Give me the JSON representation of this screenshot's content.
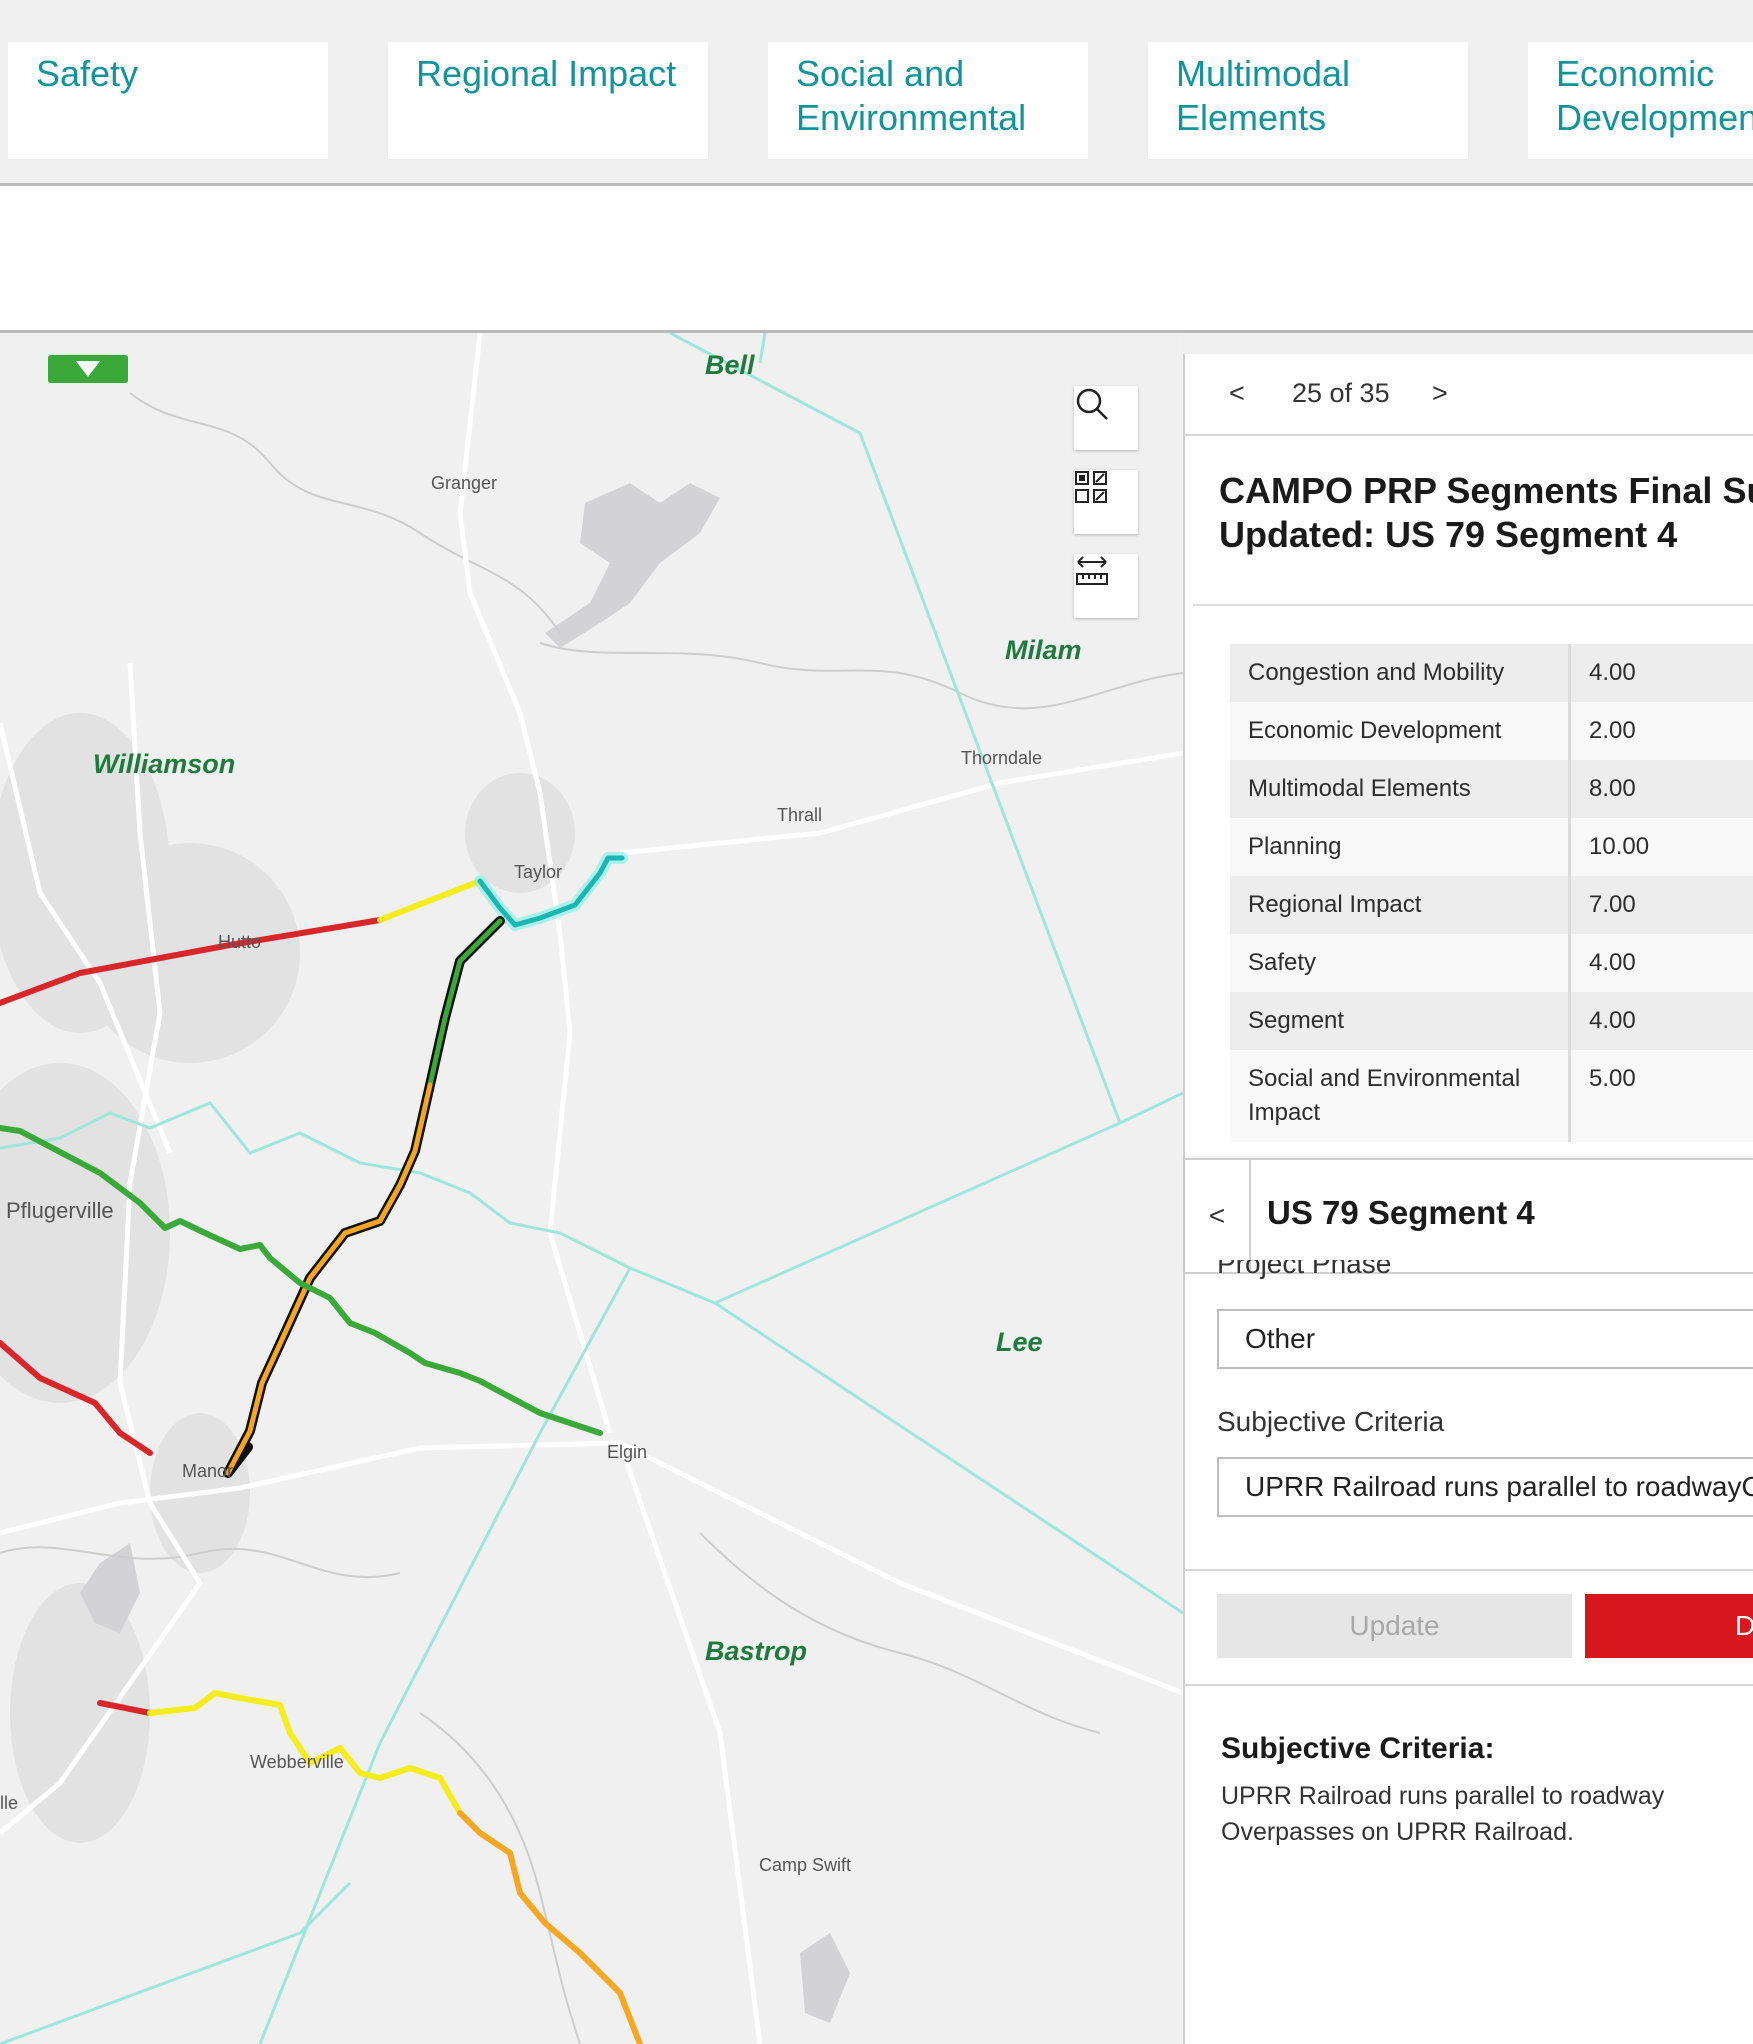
{
  "tabs": [
    {
      "line1": "Safety",
      "line2": ""
    },
    {
      "line1": "Regional Impact",
      "line2": ""
    },
    {
      "line1": "Social and",
      "line2": "Environmental"
    },
    {
      "line1": "Multimodal",
      "line2": "Elements"
    },
    {
      "line1": "Economic",
      "line2": "Development"
    }
  ],
  "map": {
    "counties": [
      "Bell",
      "Milam",
      "Williamson",
      "Lee",
      "Bastrop"
    ],
    "places": [
      "Granger",
      "Thorndale",
      "Thrall",
      "Taylor",
      "Hutto",
      "Pflugerville",
      "Manor",
      "Elgin",
      "Webberville",
      "Camp Swift",
      "lle"
    ],
    "tools": {
      "search": "search-icon",
      "select": "select-grid-icon",
      "measure": "measure-icon"
    },
    "colors": {
      "red": "#d9262a",
      "yellow": "#f4ec1c",
      "green": "#3aa93a",
      "orange": "#f5a623",
      "cyan": "#4fd9d2",
      "boundary": "#9ee6da"
    }
  },
  "popup": {
    "pager": {
      "prev": "<",
      "count": "25 of 35",
      "next": ">"
    },
    "title_line1": "CAMPO PRP Segments Final Su",
    "title_line2": "Updated: US 79 Segment 4",
    "attributes": [
      {
        "key": "Congestion and Mobility",
        "value": "4.00"
      },
      {
        "key": "Economic Development",
        "value": "2.00"
      },
      {
        "key": "Multimodal Elements",
        "value": "8.00"
      },
      {
        "key": "Planning",
        "value": "10.00"
      },
      {
        "key": "Regional Impact",
        "value": "7.00"
      },
      {
        "key": "Safety",
        "value": "4.00"
      },
      {
        "key": "Segment",
        "value": "4.00"
      },
      {
        "key": "Social and Environmental Impact",
        "value": "5.00"
      }
    ]
  },
  "edit": {
    "back": "<",
    "title": "US 79 Segment 4",
    "project_phase_label": "Project Phase",
    "project_phase_value": "Other",
    "subjective_label": "Subjective Criteria",
    "subjective_value": "UPRR Railroad runs parallel to roadwayO",
    "update_label": "Update",
    "delete_label": "Delete"
  },
  "summary": {
    "heading": "Subjective Criteria:",
    "line1": "UPRR Railroad runs parallel to roadway",
    "line2": "Overpasses on UPRR Railroad."
  }
}
